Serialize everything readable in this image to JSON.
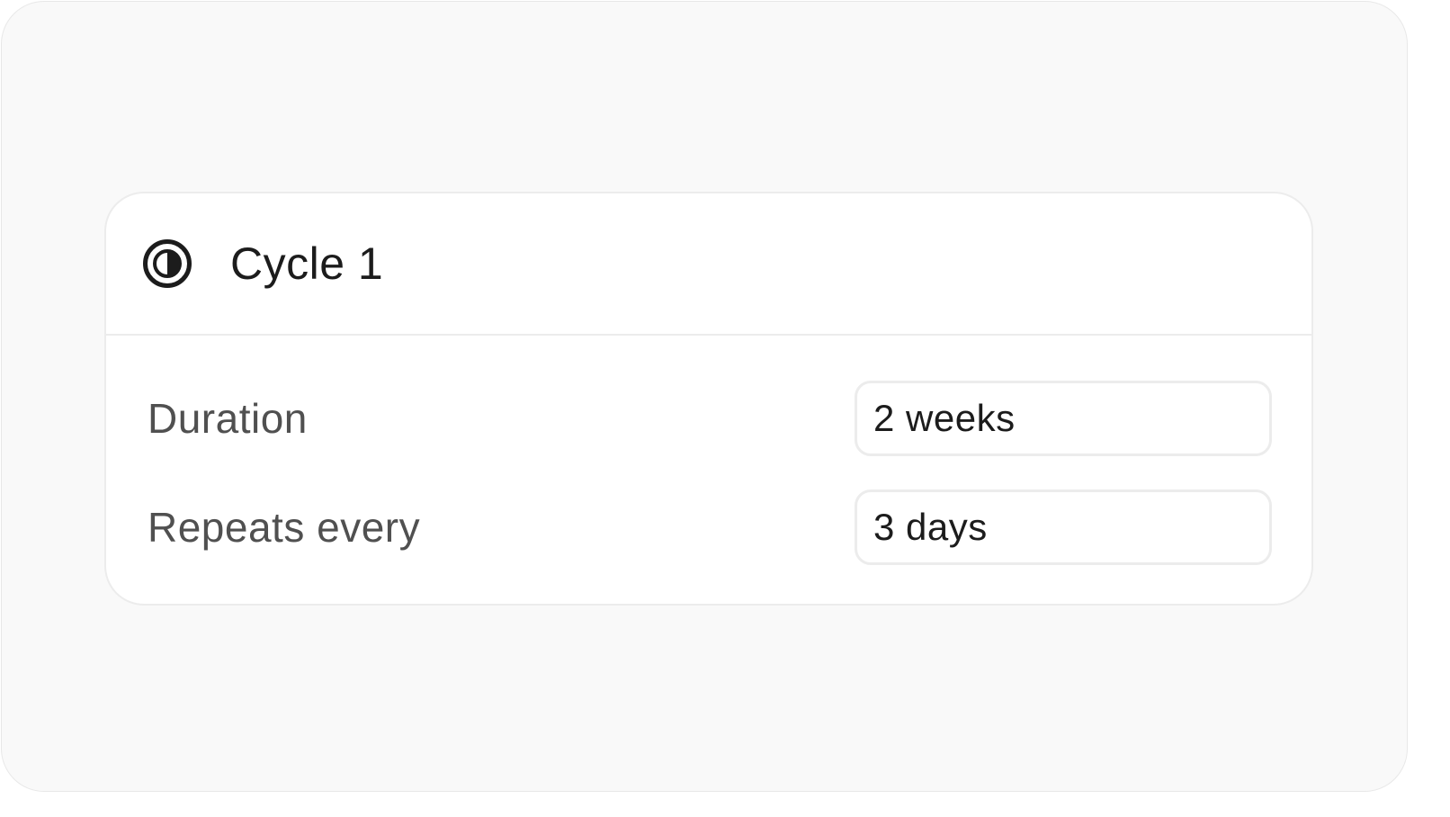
{
  "cycle": {
    "title": "Cycle 1",
    "icon": "half-circle-icon"
  },
  "settings": {
    "duration_label": "Duration",
    "duration_value": "2 weeks",
    "repeats_label": "Repeats every",
    "repeats_value": "3 days"
  },
  "colors": {
    "background": "#f9f9f9",
    "card": "#ffffff",
    "border": "#ececec",
    "title_text": "#1c1c1c",
    "label_text": "#505050"
  }
}
